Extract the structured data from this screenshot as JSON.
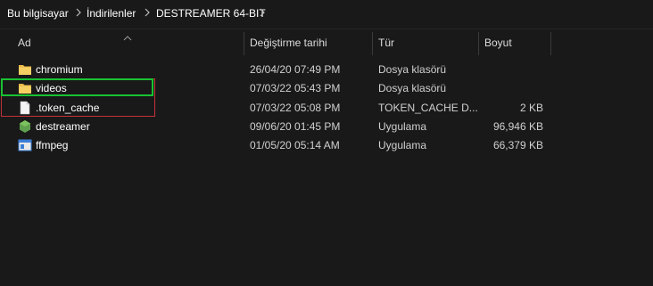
{
  "breadcrumb": {
    "items": [
      "Bu bilgisayar",
      "İndirilenler",
      "DESTREAMER 64-BIT"
    ]
  },
  "columns": {
    "name": "Ad",
    "modified": "Değiştirme tarihi",
    "type": "Tür",
    "size": "Boyut"
  },
  "files": [
    {
      "name": "chromium",
      "modified": "26/04/20 07:49 PM",
      "type": "Dosya klasörü",
      "size": "",
      "icon": "folder-icon"
    },
    {
      "name": "videos",
      "modified": "07/03/22 05:43 PM",
      "type": "Dosya klasörü",
      "size": "",
      "icon": "folder-icon"
    },
    {
      "name": ".token_cache",
      "modified": "07/03/22 05:08 PM",
      "type": "TOKEN_CACHE D...",
      "size": "2 KB",
      "icon": "file-icon"
    },
    {
      "name": "destreamer",
      "modified": "09/06/20 01:45 PM",
      "type": "Uygulama",
      "size": "96,946 KB",
      "icon": "node-app-icon"
    },
    {
      "name": "ffmpeg",
      "modified": "01/05/20 05:14 AM",
      "type": "Uygulama",
      "size": "66,379 KB",
      "icon": "exe-app-icon"
    }
  ],
  "colors": {
    "background": "#191919",
    "highlight_green": "#19c232",
    "highlight_red": "#c4323a",
    "folder": "#f0c654"
  }
}
